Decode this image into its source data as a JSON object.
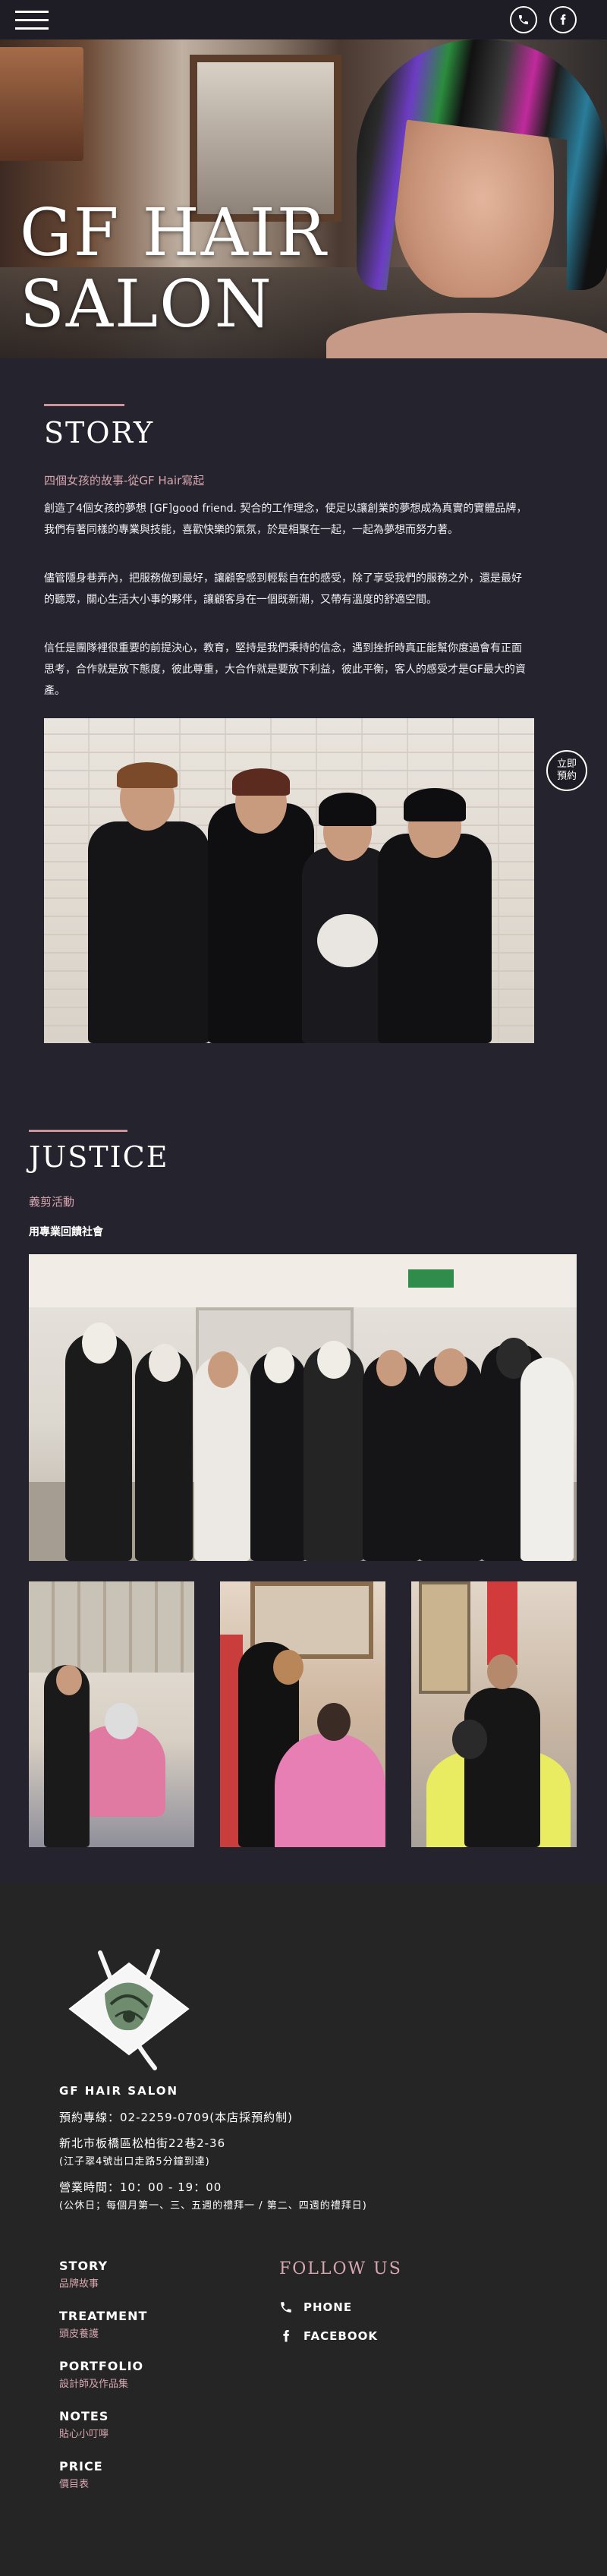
{
  "header": {
    "menu_icon": "hamburger-menu-icon",
    "phone_icon": "phone-icon",
    "facebook_icon": "facebook-icon"
  },
  "hero": {
    "title_line1": "GF HAIR",
    "title_line2": "SALON"
  },
  "story": {
    "title": "STORY",
    "subtitle": "四個女孩的故事-從GF Hair寫起",
    "paragraphs": [
      "創造了4個女孩的夢想 [GF]good friend. 契合的工作理念，使足以讓創業的夢想成為真實的實體品牌，我們有著同樣的專業與技能，喜歡快樂的氣氛，於是相聚在一起，一起為夢想而努力著。",
      "儘管隱身巷弄內，把服務做到最好，讓顧客感到輕鬆自在的感受，除了享受我們的服務之外，還是最好的聽眾，關心生活大小事的夥伴，讓顧客身在一個既新潮，又帶有溫度的舒適空間。",
      "信任是團隊裡很重要的前提決心，教育，堅持是我們秉持的信念，遇到挫折時真正能幫你度過會有正面思考，合作就是放下態度，彼此尊重，大合作就是要放下利益，彼此平衡，客人的感受才是GF最大的資產。"
    ]
  },
  "reserve_button": {
    "line1": "立即",
    "line2": "預約"
  },
  "justice": {
    "title": "JUSTICE",
    "subtitle": "義剪活動",
    "tagline": "用專業回饋社會"
  },
  "footer": {
    "brand": "GF HAIR SALON",
    "phone": "預約專線：02-2259-0709(本店採預約制)",
    "address": "新北市板橋區松柏街22巷2-36",
    "address_note": "(江子翠4號出口走路5分鐘到達)",
    "hours": "營業時間：10：00 - 19：00",
    "hours_note": "(公休日；每個月第一、三、五週的禮拜一 / 第二、四週的禮拜日)",
    "nav": [
      {
        "en": "STORY",
        "zh": "品牌故事"
      },
      {
        "en": "TREATMENT",
        "zh": "頭皮養護"
      },
      {
        "en": "PORTFOLIO",
        "zh": "設計師及作品集"
      },
      {
        "en": "NOTES",
        "zh": "貼心小叮嚀"
      },
      {
        "en": "PRICE",
        "zh": "價目表"
      }
    ],
    "follow_title": "FOLLOW US",
    "social": [
      {
        "label": "PHONE",
        "icon": "phone-icon"
      },
      {
        "label": "FACEBOOK",
        "icon": "facebook-icon"
      }
    ]
  },
  "colors": {
    "background": "#25232d",
    "footer": "#252525",
    "accent_pink": "#d7a7b0"
  }
}
